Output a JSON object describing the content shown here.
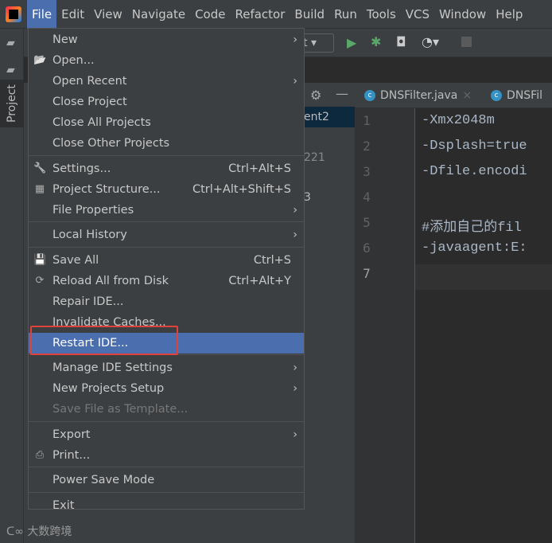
{
  "menubar": {
    "items": [
      "File",
      "Edit",
      "View",
      "Navigate",
      "Code",
      "Refactor",
      "Build",
      "Run",
      "Tools",
      "VCS",
      "Window",
      "Help"
    ],
    "active": "File"
  },
  "toolbar": {
    "config_fragment": "t"
  },
  "project_tab": "Project",
  "project_panel": {
    "fragments": [
      "ent2",
      "221",
      "3"
    ]
  },
  "editor": {
    "tabs": [
      {
        "label": "DNSFilter.java"
      },
      {
        "label": "DNSFil"
      }
    ],
    "lines": [
      "-Xmx2048m",
      "-Dsplash=true",
      "-Dfile.encodi",
      "",
      "#添加自己的fil",
      "-javaagent:E:",
      ""
    ],
    "line_numbers": [
      "1",
      "2",
      "3",
      "4",
      "5",
      "6",
      "7"
    ],
    "current_line": 7
  },
  "file_menu": {
    "groups": [
      [
        {
          "label": "New",
          "submenu": true
        },
        {
          "label": "Open...",
          "icon": "folder-open-icon"
        },
        {
          "label": "Open Recent",
          "submenu": true
        },
        {
          "label": "Close Project"
        },
        {
          "label": "Close All Projects"
        },
        {
          "label": "Close Other Projects"
        }
      ],
      [
        {
          "label": "Settings...",
          "shortcut": "Ctrl+Alt+S",
          "icon": "wrench-icon"
        },
        {
          "label": "Project Structure...",
          "shortcut": "Ctrl+Alt+Shift+S",
          "icon": "project-structure-icon"
        },
        {
          "label": "File Properties",
          "submenu": true
        }
      ],
      [
        {
          "label": "Local History",
          "submenu": true
        }
      ],
      [
        {
          "label": "Save All",
          "shortcut": "Ctrl+S",
          "icon": "save-icon"
        },
        {
          "label": "Reload All from Disk",
          "shortcut": "Ctrl+Alt+Y",
          "icon": "reload-icon"
        },
        {
          "label": "Repair IDE..."
        },
        {
          "label": "Invalidate Caches..."
        },
        {
          "label": "Restart IDE...",
          "selected": true
        }
      ],
      [
        {
          "label": "Manage IDE Settings",
          "submenu": true
        },
        {
          "label": "New Projects Setup",
          "submenu": true
        },
        {
          "label": "Save File as Template...",
          "disabled": true
        }
      ],
      [
        {
          "label": "Export",
          "submenu": true
        },
        {
          "label": "Print...",
          "icon": "print-icon"
        }
      ],
      [
        {
          "label": "Power Save Mode"
        }
      ],
      [
        {
          "label": "Exit"
        }
      ]
    ]
  },
  "highlight_color": "#e0413a",
  "watermark": "大数跨境"
}
